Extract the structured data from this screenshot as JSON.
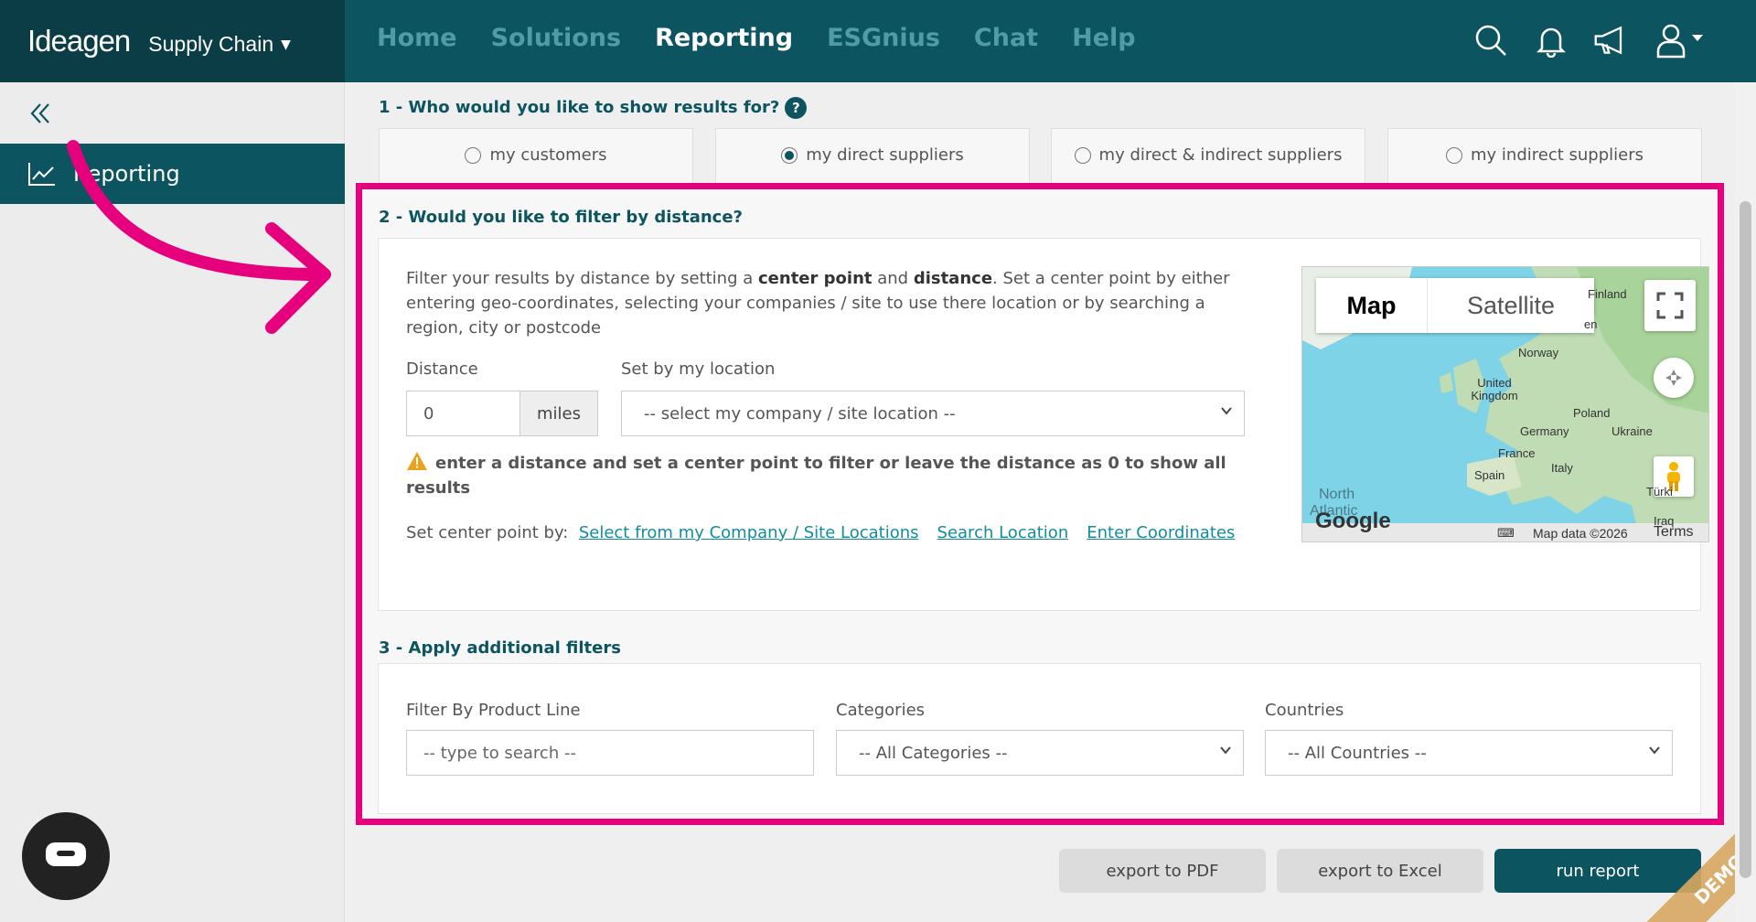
{
  "header": {
    "brand": "Ideagen",
    "product": "Supply Chain",
    "nav": [
      "Home",
      "Solutions",
      "Reporting",
      "ESGnius",
      "Chat",
      "Help"
    ]
  },
  "sidebar": {
    "item": "Reporting"
  },
  "s1": {
    "title": "1 - Who would you like to show results for?",
    "help": "?",
    "options": [
      "my customers",
      "my direct suppliers",
      "my direct & indirect suppliers",
      "my indirect suppliers"
    ]
  },
  "s2": {
    "title": "2 - Would you like to filter by distance?",
    "desc_a": "Filter your results by distance by setting a ",
    "desc_b": "center point",
    "desc_c": " and ",
    "desc_d": "distance",
    "desc_e": ". Set a center point by either entering geo-coordinates, selecting your companies / site to use there location or by searching a region, city or postcode",
    "distance_label": "Distance",
    "distance_value": "0",
    "unit": "miles",
    "location_label": "Set by my location",
    "location_select": "-- select my company / site location --",
    "warning": "enter a distance and set a center point to filter or leave the distance as 0 to show all results",
    "center_label": "Set center point by:",
    "link1": "Select from my Company / Site Locations",
    "link2": "Search Location",
    "link3": "Enter Coordinates",
    "map": {
      "btn_map": "Map",
      "btn_sat": "Satellite",
      "places": [
        "Finland",
        "en",
        "Norway",
        "United Kingdom",
        "Poland",
        "Germany",
        "Ukraine",
        "France",
        "Italy",
        "Spain",
        "Türki",
        "North",
        "Atlantic",
        "Iraq"
      ],
      "google": "Google",
      "mapdata": "Map data ©2026",
      "terms": "Terms"
    }
  },
  "s3": {
    "title": "3 - Apply additional filters",
    "product_label": "Filter By Product Line",
    "product_placeholder": "-- type to search --",
    "cat_label": "Categories",
    "cat_value": "-- All Categories --",
    "country_label": "Countries",
    "country_value": "-- All Countries --"
  },
  "footer": {
    "pdf": "export to PDF",
    "excel": "export to Excel",
    "run": "run report",
    "demo": "DEMO"
  },
  "colors": {
    "teal": "#0c5460",
    "highlight": "#e6007e",
    "link": "#138c9e"
  }
}
